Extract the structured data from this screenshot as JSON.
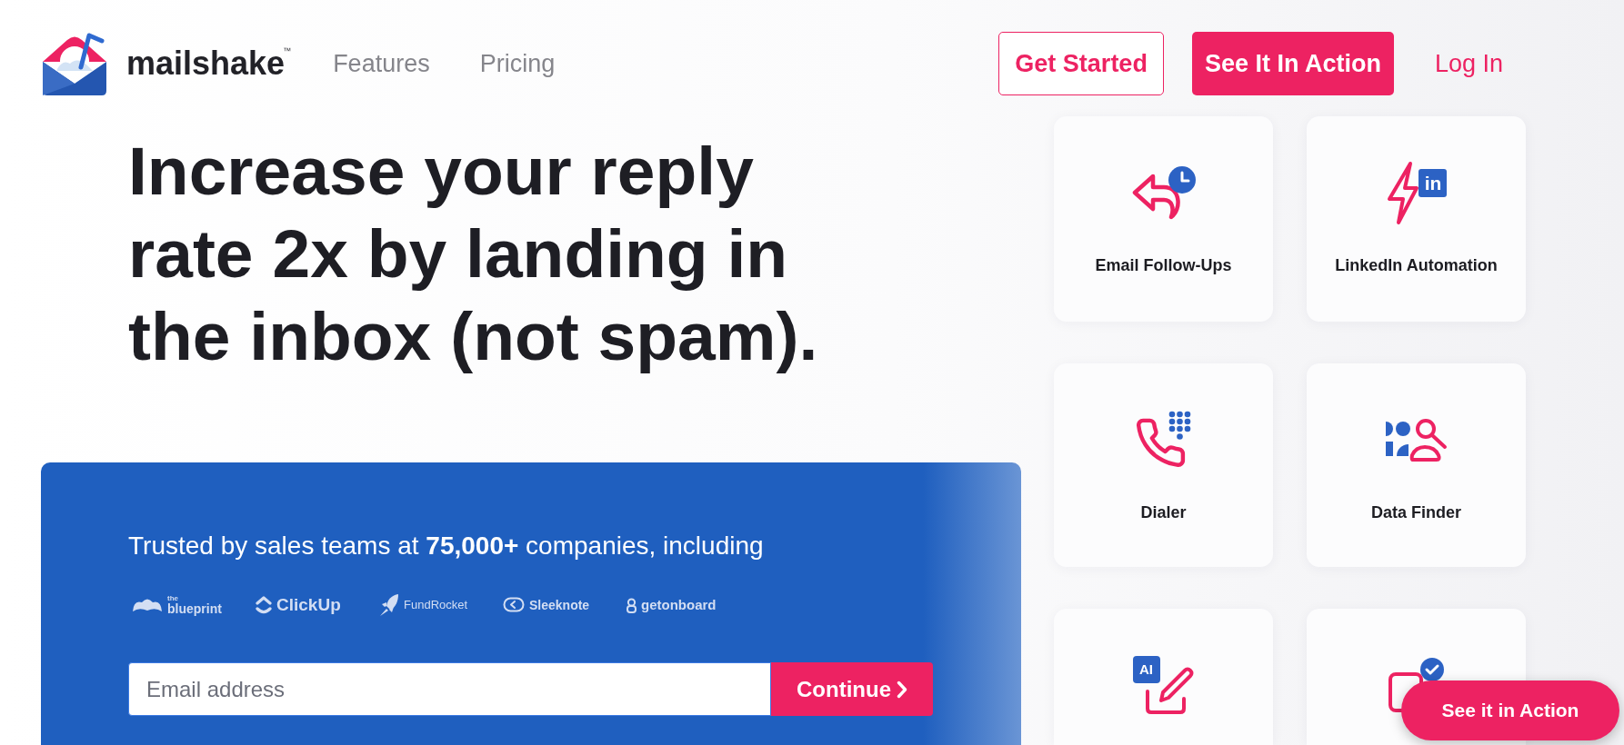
{
  "header": {
    "logo": {
      "wordmark": "mailshake",
      "mark": "™"
    },
    "nav": [
      {
        "label": "Features"
      },
      {
        "label": "Pricing"
      }
    ],
    "actions": [
      {
        "kind": "outline",
        "label": "Get Started"
      },
      {
        "kind": "filled",
        "label": "See It In Action"
      },
      {
        "kind": "link",
        "label": "Log In"
      }
    ]
  },
  "hero": {
    "headline": "Increase your reply rate 2x by landing in the inbox (not spam).",
    "trust_text": "Trusted by sales teams at **75,000+** companies, including",
    "logos": [
      {
        "kind": "blueprint",
        "prefix": "the",
        "name": "blueprint"
      },
      {
        "kind": "clickup",
        "name": "ClickUp"
      },
      {
        "kind": "fundrocket",
        "name": "FundRocket"
      },
      {
        "kind": "sleeknote",
        "name": "Sleeknote"
      },
      {
        "kind": "getonboard",
        "name": "getonboard"
      }
    ],
    "email_field": {
      "placeholder": "Email address"
    },
    "submit": {
      "label": "Continue"
    }
  },
  "features": [
    {
      "kind": "follow-ups",
      "label": "Email Follow-Ups"
    },
    {
      "kind": "linkedin",
      "label": "LinkedIn Automation",
      "badge": "in"
    },
    {
      "kind": "dialer",
      "label": "Dialer"
    },
    {
      "kind": "data-finder",
      "label": "Data Finder"
    },
    {
      "kind": "ai-writer",
      "badge": "AI"
    },
    {
      "kind": "check"
    }
  ],
  "floating_button": {
    "label": "See it in Action"
  }
}
